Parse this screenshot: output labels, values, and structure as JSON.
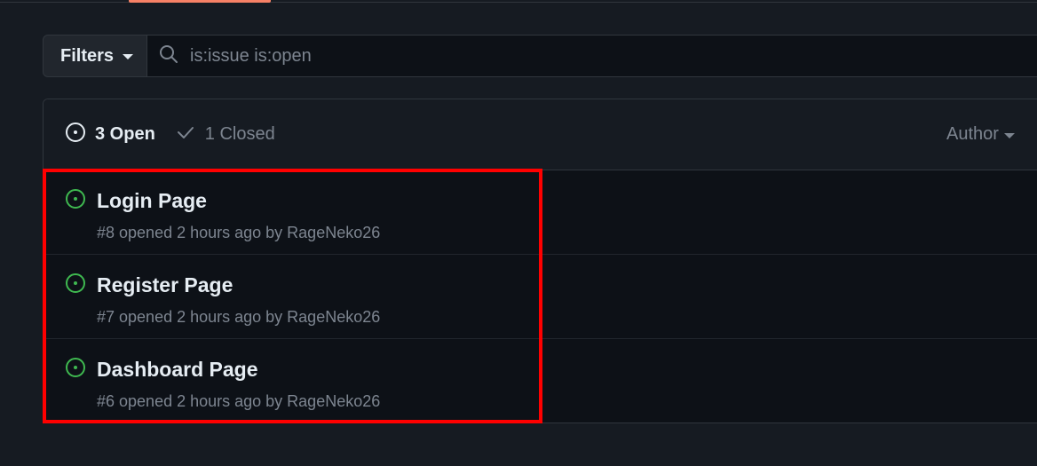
{
  "filters": {
    "button_label": "Filters",
    "search_value": "is:issue is:open"
  },
  "issues_header": {
    "open_label": "3 Open",
    "closed_label": "1 Closed",
    "author_label": "Author"
  },
  "issues": [
    {
      "title": "Login Page",
      "meta": "#8 opened 2 hours ago by RageNeko26"
    },
    {
      "title": "Register Page",
      "meta": "#7 opened 2 hours ago by RageNeko26"
    },
    {
      "title": "Dashboard Page",
      "meta": "#6 opened 2 hours ago by RageNeko26"
    }
  ],
  "colors": {
    "open_issue": "#3fb950",
    "accent_underline": "#f78166",
    "highlight": "#ff0000"
  },
  "icons": {
    "search": "search-icon",
    "open_state": "issue-opened-icon",
    "closed_state": "check-icon",
    "caret": "triangle-down-icon"
  }
}
